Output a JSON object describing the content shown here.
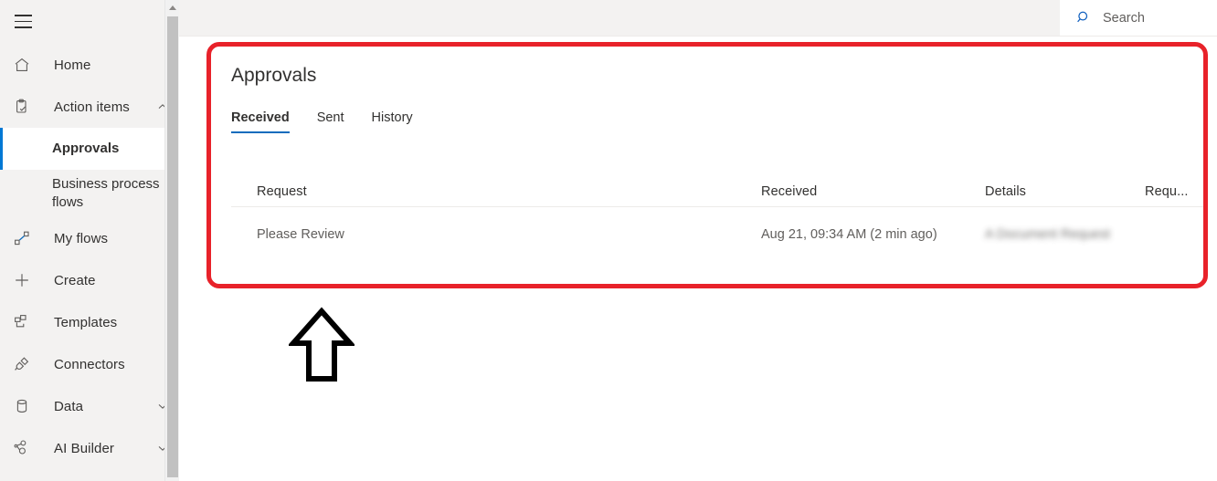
{
  "sidebar": {
    "menu_icon": "hamburger-icon",
    "items": [
      {
        "label": "Home",
        "icon": "home-icon",
        "chevron": "",
        "type": "item"
      },
      {
        "label": "Action items",
        "icon": "clipboard-check-icon",
        "chevron": "∧",
        "type": "item"
      },
      {
        "label": "Approvals",
        "icon": "",
        "chevron": "",
        "type": "sub",
        "active": true
      },
      {
        "label": "Business process flows",
        "icon": "",
        "chevron": "",
        "type": "sub",
        "active": false
      },
      {
        "label": "My flows",
        "icon": "flow-icon",
        "chevron": "",
        "type": "item"
      },
      {
        "label": "Create",
        "icon": "plus-icon",
        "chevron": "",
        "type": "item"
      },
      {
        "label": "Templates",
        "icon": "templates-icon",
        "chevron": "",
        "type": "item"
      },
      {
        "label": "Connectors",
        "icon": "connectors-icon",
        "chevron": "",
        "type": "item"
      },
      {
        "label": "Data",
        "icon": "database-icon",
        "chevron": "∨",
        "type": "item"
      },
      {
        "label": "AI Builder",
        "icon": "ai-builder-icon",
        "chevron": "∨",
        "type": "item"
      }
    ]
  },
  "topbar": {
    "search": {
      "icon": "search-icon",
      "text": "Search",
      "placeholder": "Search"
    }
  },
  "approvals": {
    "title": "Approvals",
    "tabs": [
      {
        "label": "Received",
        "active": true
      },
      {
        "label": "Sent",
        "active": false
      },
      {
        "label": "History",
        "active": false
      }
    ],
    "table": {
      "columns": [
        "Request",
        "Received",
        "Details",
        "Requ..."
      ],
      "rows": [
        {
          "request": "Please Review",
          "received": "Aug 21, 09:34 AM (2 min ago)",
          "details": "A Document Request",
          "requester": ""
        }
      ]
    }
  },
  "annotations": {
    "highlight_color": "#e8222a",
    "arrow": "up-arrow-annotation",
    "arrow_color": "#000000"
  }
}
